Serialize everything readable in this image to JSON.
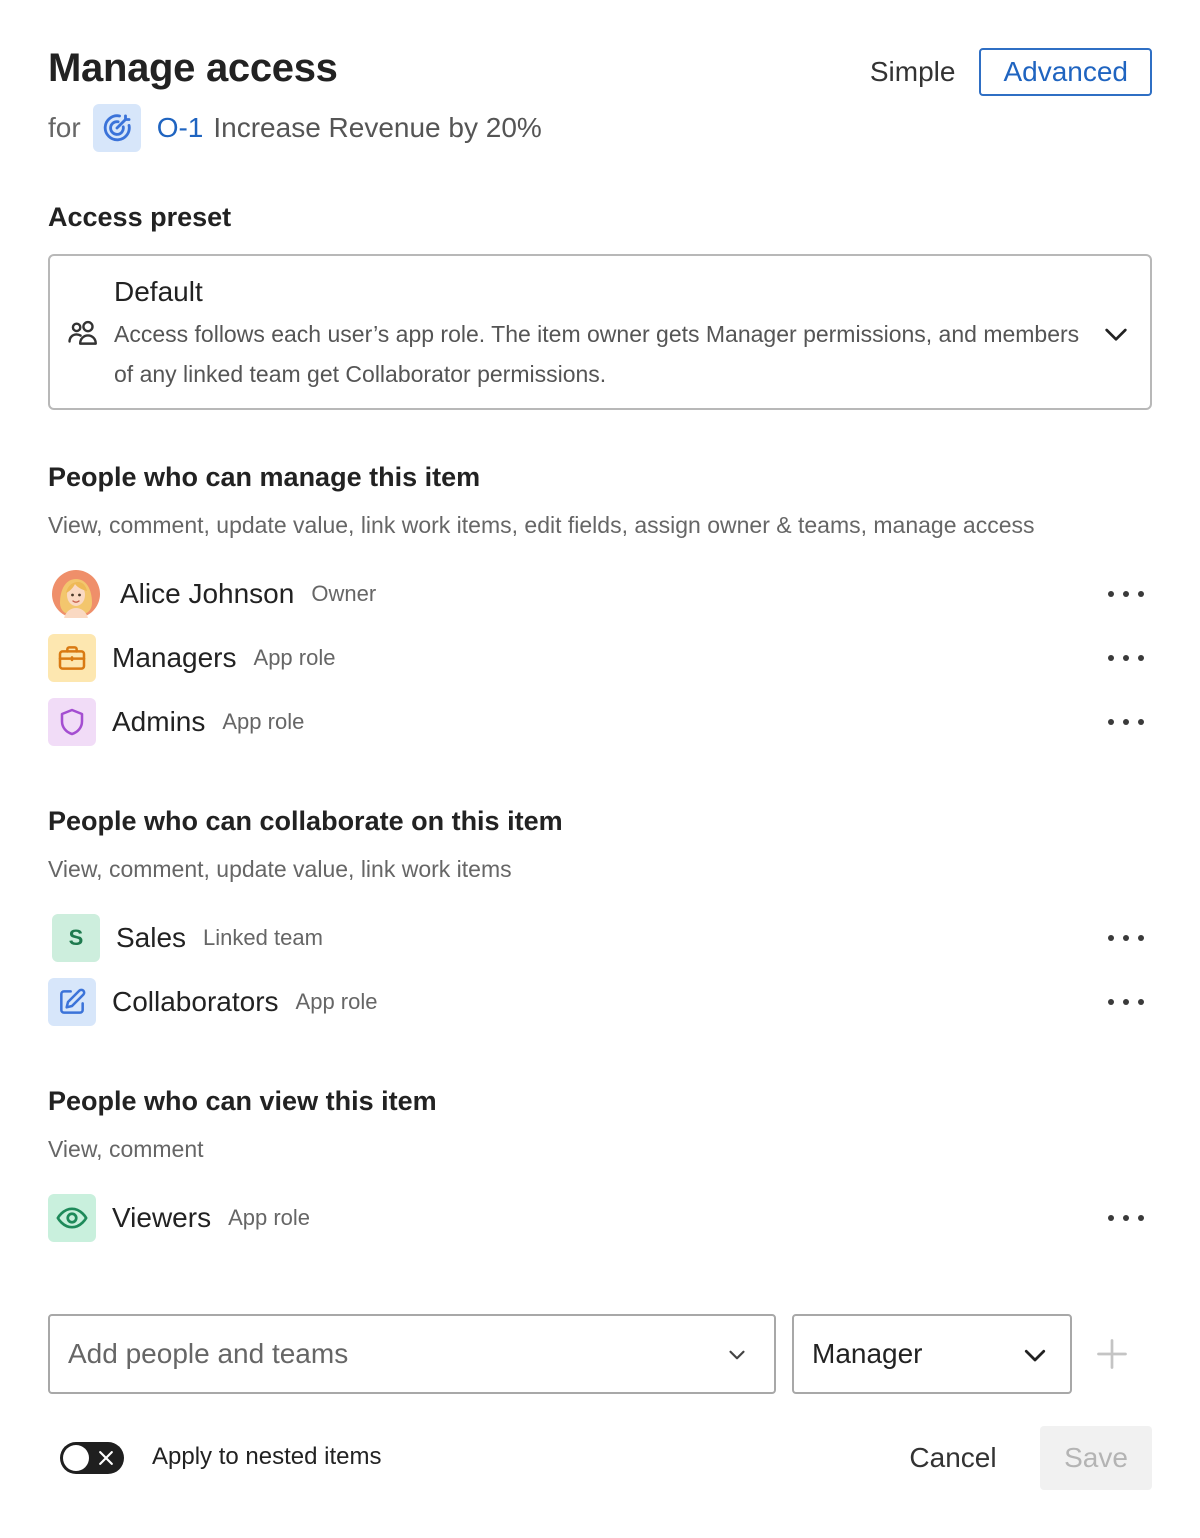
{
  "dialog": {
    "title": "Manage access",
    "mode": {
      "simple_label": "Simple",
      "advanced_label": "Advanced",
      "selected": "Advanced"
    }
  },
  "for_item": {
    "for_label": "for",
    "icon": "goal-target-icon",
    "key": "O-1",
    "name": "Increase Revenue by 20%"
  },
  "access_preset": {
    "heading": "Access preset",
    "selected": {
      "icon": "people-icon",
      "name": "Default",
      "description": "Access follows each user’s app role. The item owner gets Manager permissions, and members of any linked team get Collaborator permissions."
    }
  },
  "sections": {
    "manage": {
      "title": "People who can manage this item",
      "subtitle": "View, comment, update value, link work items, edit fields, assign owner & teams, manage access",
      "rows": [
        {
          "name": "Alice Johnson",
          "tag": "Owner",
          "icon": "user-avatar"
        },
        {
          "name": "Managers",
          "tag": "App role",
          "icon": "briefcase-icon"
        },
        {
          "name": "Admins",
          "tag": "App role",
          "icon": "shield-icon"
        }
      ]
    },
    "collaborate": {
      "title": "People who can collaborate on this item",
      "subtitle": "View, comment, update value, link work items",
      "rows": [
        {
          "name": "Sales",
          "tag": "Linked team",
          "icon": "team-initial",
          "initial": "S"
        },
        {
          "name": "Collaborators",
          "tag": "App role",
          "icon": "edit-icon"
        }
      ]
    },
    "view": {
      "title": "People who can view this item",
      "subtitle": "View, comment",
      "rows": [
        {
          "name": "Viewers",
          "tag": "App role",
          "icon": "eye-icon"
        }
      ]
    }
  },
  "add_people": {
    "placeholder": "Add people and teams",
    "role_value": "Manager"
  },
  "nested": {
    "label": "Apply to nested items",
    "enabled": false
  },
  "footer": {
    "cancel_label": "Cancel",
    "save_label": "Save"
  },
  "colors": {
    "accent": "#1f64c0",
    "briefcase_bg": "#fde7b0",
    "shield_bg": "#f1dcf7",
    "sales_bg": "#cdeedd",
    "edit_bg": "#d7e6fa",
    "eye_bg": "#c9f0dd"
  }
}
